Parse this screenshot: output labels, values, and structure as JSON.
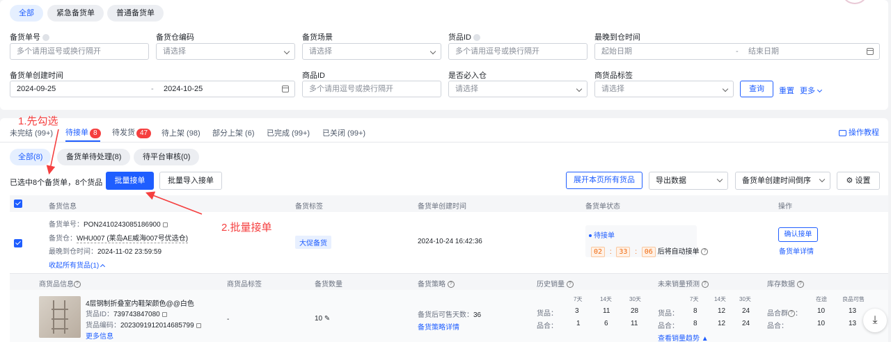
{
  "filter_tabs": [
    "全部",
    "紧急备货单",
    "普通备货单"
  ],
  "filters": {
    "order_no": {
      "label": "备货单号",
      "placeholder": "多个请用逗号或换行隔开"
    },
    "warehouse_code": {
      "label": "备货仓编码",
      "placeholder": "请选择"
    },
    "scene": {
      "label": "备货场景",
      "placeholder": "请选择"
    },
    "goods_id": {
      "label": "货品ID",
      "placeholder": "多个请用逗号或换行隔开"
    },
    "latest_arrival": {
      "label": "最晚到仓时间",
      "start": "起始日期",
      "end": "结束日期"
    },
    "created": {
      "label": "备货单创建时间",
      "start": "2024-09-25",
      "end": "2024-10-25",
      "dash": "-"
    },
    "product_id": {
      "label": "商品ID",
      "placeholder": "多个请用逗号或换行隔开"
    },
    "must_enter": {
      "label": "是否必入仓",
      "placeholder": "请选择"
    },
    "product_tag": {
      "label": "商货品标签",
      "placeholder": "请选择"
    },
    "search_btn": "查询",
    "reset_btn": "重置",
    "more_btn": "更多"
  },
  "status_tabs": [
    {
      "label": "未完结 (99+)"
    },
    {
      "label": "待接单",
      "badge": "8"
    },
    {
      "label": "待发货",
      "badge": "47"
    },
    {
      "label": "待上架 (98)"
    },
    {
      "label": "部分上架 (6)"
    },
    {
      "label": "已完成 (99+)"
    },
    {
      "label": "已关闭 (99+)"
    }
  ],
  "tutorial_link": "操作教程",
  "sub_tabs": [
    "全部(8)",
    "备货单待处理(8)",
    "待平台审核(0)"
  ],
  "selection_text": "已选中8个备货单，8个货品",
  "batch_accept_btn": "批量接单",
  "batch_import_btn": "批量导入接单",
  "expand_all_btn": "展开本页所有货品",
  "export_select": "导出数据",
  "sort_select": "备货单创建时间倒序",
  "settings_btn": "设置",
  "table_headers": [
    "备货信息",
    "备货标签",
    "备货单创建时间",
    "备货单状态",
    "操作"
  ],
  "order": {
    "no_label": "备货单号：",
    "no": "PON2410243085186900",
    "warehouse_label": "备货仓：",
    "warehouse": "WHU007 (莱岛AE威海007号优选仓)",
    "latest_label": "最晚到仓时间：",
    "latest": "2024-11-02 23:59:59",
    "collapse": "收起所有货品(1)",
    "tag": "大促备货",
    "created": "2024-10-24 16:42:36",
    "status": "待接单",
    "countdown": [
      "02",
      "33",
      "06"
    ],
    "countdown_sep": ":",
    "countdown_text": "后将自动接单",
    "confirm_btn": "确认接单",
    "detail_link": "备货单详情"
  },
  "sub_headers": [
    "商货品信息",
    "商货品标签",
    "备货数量",
    "备货策略",
    "历史销量",
    "未来销量预测",
    "库存数据"
  ],
  "item": {
    "name": "4层钢制折叠室内鞋架颜色@@白色",
    "goods_id_label": "货品ID：",
    "goods_id": "739743847080",
    "code_label": "货品编码：",
    "code": "20230919120146857​99",
    "more": "更多信息",
    "tag": "-",
    "qty": "10",
    "strategy_label": "备货后可售天数：",
    "strategy_days": "36",
    "strategy_link": "备货策略详情",
    "hist_cols": [
      "7天",
      "14天",
      "30天"
    ],
    "hist_rows": [
      {
        "label": "货品：",
        "vals": [
          "3",
          "11",
          "28"
        ]
      },
      {
        "label": "品合：",
        "vals": [
          "1",
          "6",
          "11"
        ]
      }
    ],
    "future_cols": [
      "7天",
      "14天",
      "30天"
    ],
    "future_rows": [
      {
        "label": "货品：",
        "vals": [
          "8",
          "12",
          "24"
        ]
      },
      {
        "label": "品合：",
        "vals": [
          "8",
          "12",
          "24"
        ]
      }
    ],
    "future_link": "查看销量趋势",
    "stock_cols": [
      "在途",
      "良品可售"
    ],
    "stock_rows": [
      {
        "label": "品合群",
        "vals": [
          "10",
          "13"
        ]
      },
      {
        "label": "品合：",
        "vals": [
          "10",
          "13"
        ]
      }
    ]
  },
  "annotations": {
    "step1": "1.先勾选",
    "step2": "2.批量接单"
  },
  "colors": {
    "primary": "#1f5eff",
    "danger": "#f53f3f",
    "annotation": "#f53f3f"
  }
}
